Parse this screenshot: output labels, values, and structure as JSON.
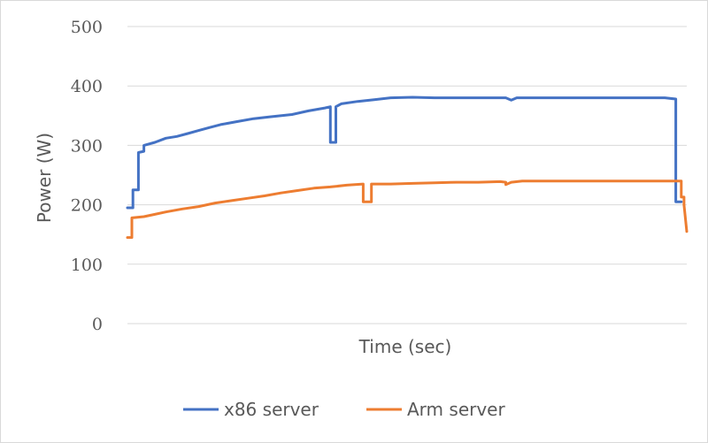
{
  "chart_data": {
    "type": "line",
    "title": "",
    "xlabel": "Time (sec)",
    "ylabel": "Power (W)",
    "ylim": [
      0,
      500
    ],
    "yticks": [
      "0",
      "100",
      "200",
      "300",
      "400",
      "500"
    ],
    "grid": "horizontal",
    "legend_position": "bottom",
    "x_axis_ticks": "none",
    "series": [
      {
        "name": "x86 server",
        "color": "#4472c4",
        "points": [
          [
            0,
            195
          ],
          [
            1,
            195
          ],
          [
            1,
            225
          ],
          [
            2,
            225
          ],
          [
            2,
            288
          ],
          [
            3,
            290
          ],
          [
            3,
            300
          ],
          [
            5,
            305
          ],
          [
            7,
            312
          ],
          [
            9,
            315
          ],
          [
            11,
            320
          ],
          [
            13,
            325
          ],
          [
            15,
            330
          ],
          [
            17,
            335
          ],
          [
            20,
            340
          ],
          [
            23,
            345
          ],
          [
            26,
            348
          ],
          [
            30,
            352
          ],
          [
            33,
            358
          ],
          [
            36,
            363
          ],
          [
            37,
            365
          ],
          [
            37,
            305
          ],
          [
            38,
            305
          ],
          [
            38,
            365
          ],
          [
            39,
            370
          ],
          [
            42,
            374
          ],
          [
            45,
            377
          ],
          [
            48,
            380
          ],
          [
            52,
            381
          ],
          [
            56,
            380
          ],
          [
            60,
            380
          ],
          [
            66,
            380
          ],
          [
            69,
            380
          ],
          [
            70,
            376
          ],
          [
            71,
            380
          ],
          [
            80,
            380
          ],
          [
            90,
            380
          ],
          [
            97,
            380
          ],
          [
            98,
            380
          ],
          [
            100,
            378
          ],
          [
            100,
            205
          ],
          [
            101,
            205
          ]
        ]
      },
      {
        "name": "Arm server",
        "color": "#ed7d31",
        "points": [
          [
            0,
            145
          ],
          [
            0.8,
            145
          ],
          [
            0.8,
            178
          ],
          [
            3,
            180
          ],
          [
            5,
            184
          ],
          [
            7,
            188
          ],
          [
            10,
            193
          ],
          [
            13,
            197
          ],
          [
            16,
            203
          ],
          [
            19,
            207
          ],
          [
            22,
            211
          ],
          [
            25,
            215
          ],
          [
            28,
            220
          ],
          [
            31,
            224
          ],
          [
            34,
            228
          ],
          [
            37,
            230
          ],
          [
            40,
            233
          ],
          [
            43,
            235
          ],
          [
            43,
            205
          ],
          [
            44.5,
            205
          ],
          [
            44.5,
            235
          ],
          [
            48,
            235
          ],
          [
            52,
            236
          ],
          [
            56,
            237
          ],
          [
            60,
            238
          ],
          [
            64,
            238
          ],
          [
            68,
            239
          ],
          [
            69,
            238
          ],
          [
            69,
            234
          ],
          [
            70,
            238
          ],
          [
            72,
            240
          ],
          [
            76,
            240
          ],
          [
            80,
            240
          ],
          [
            84,
            240
          ],
          [
            88,
            240
          ],
          [
            92,
            240
          ],
          [
            96,
            240
          ],
          [
            100,
            240
          ],
          [
            101,
            240
          ],
          [
            101,
            213
          ],
          [
            101.5,
            213
          ],
          [
            101.5,
            200
          ],
          [
            102,
            155
          ]
        ]
      }
    ]
  }
}
